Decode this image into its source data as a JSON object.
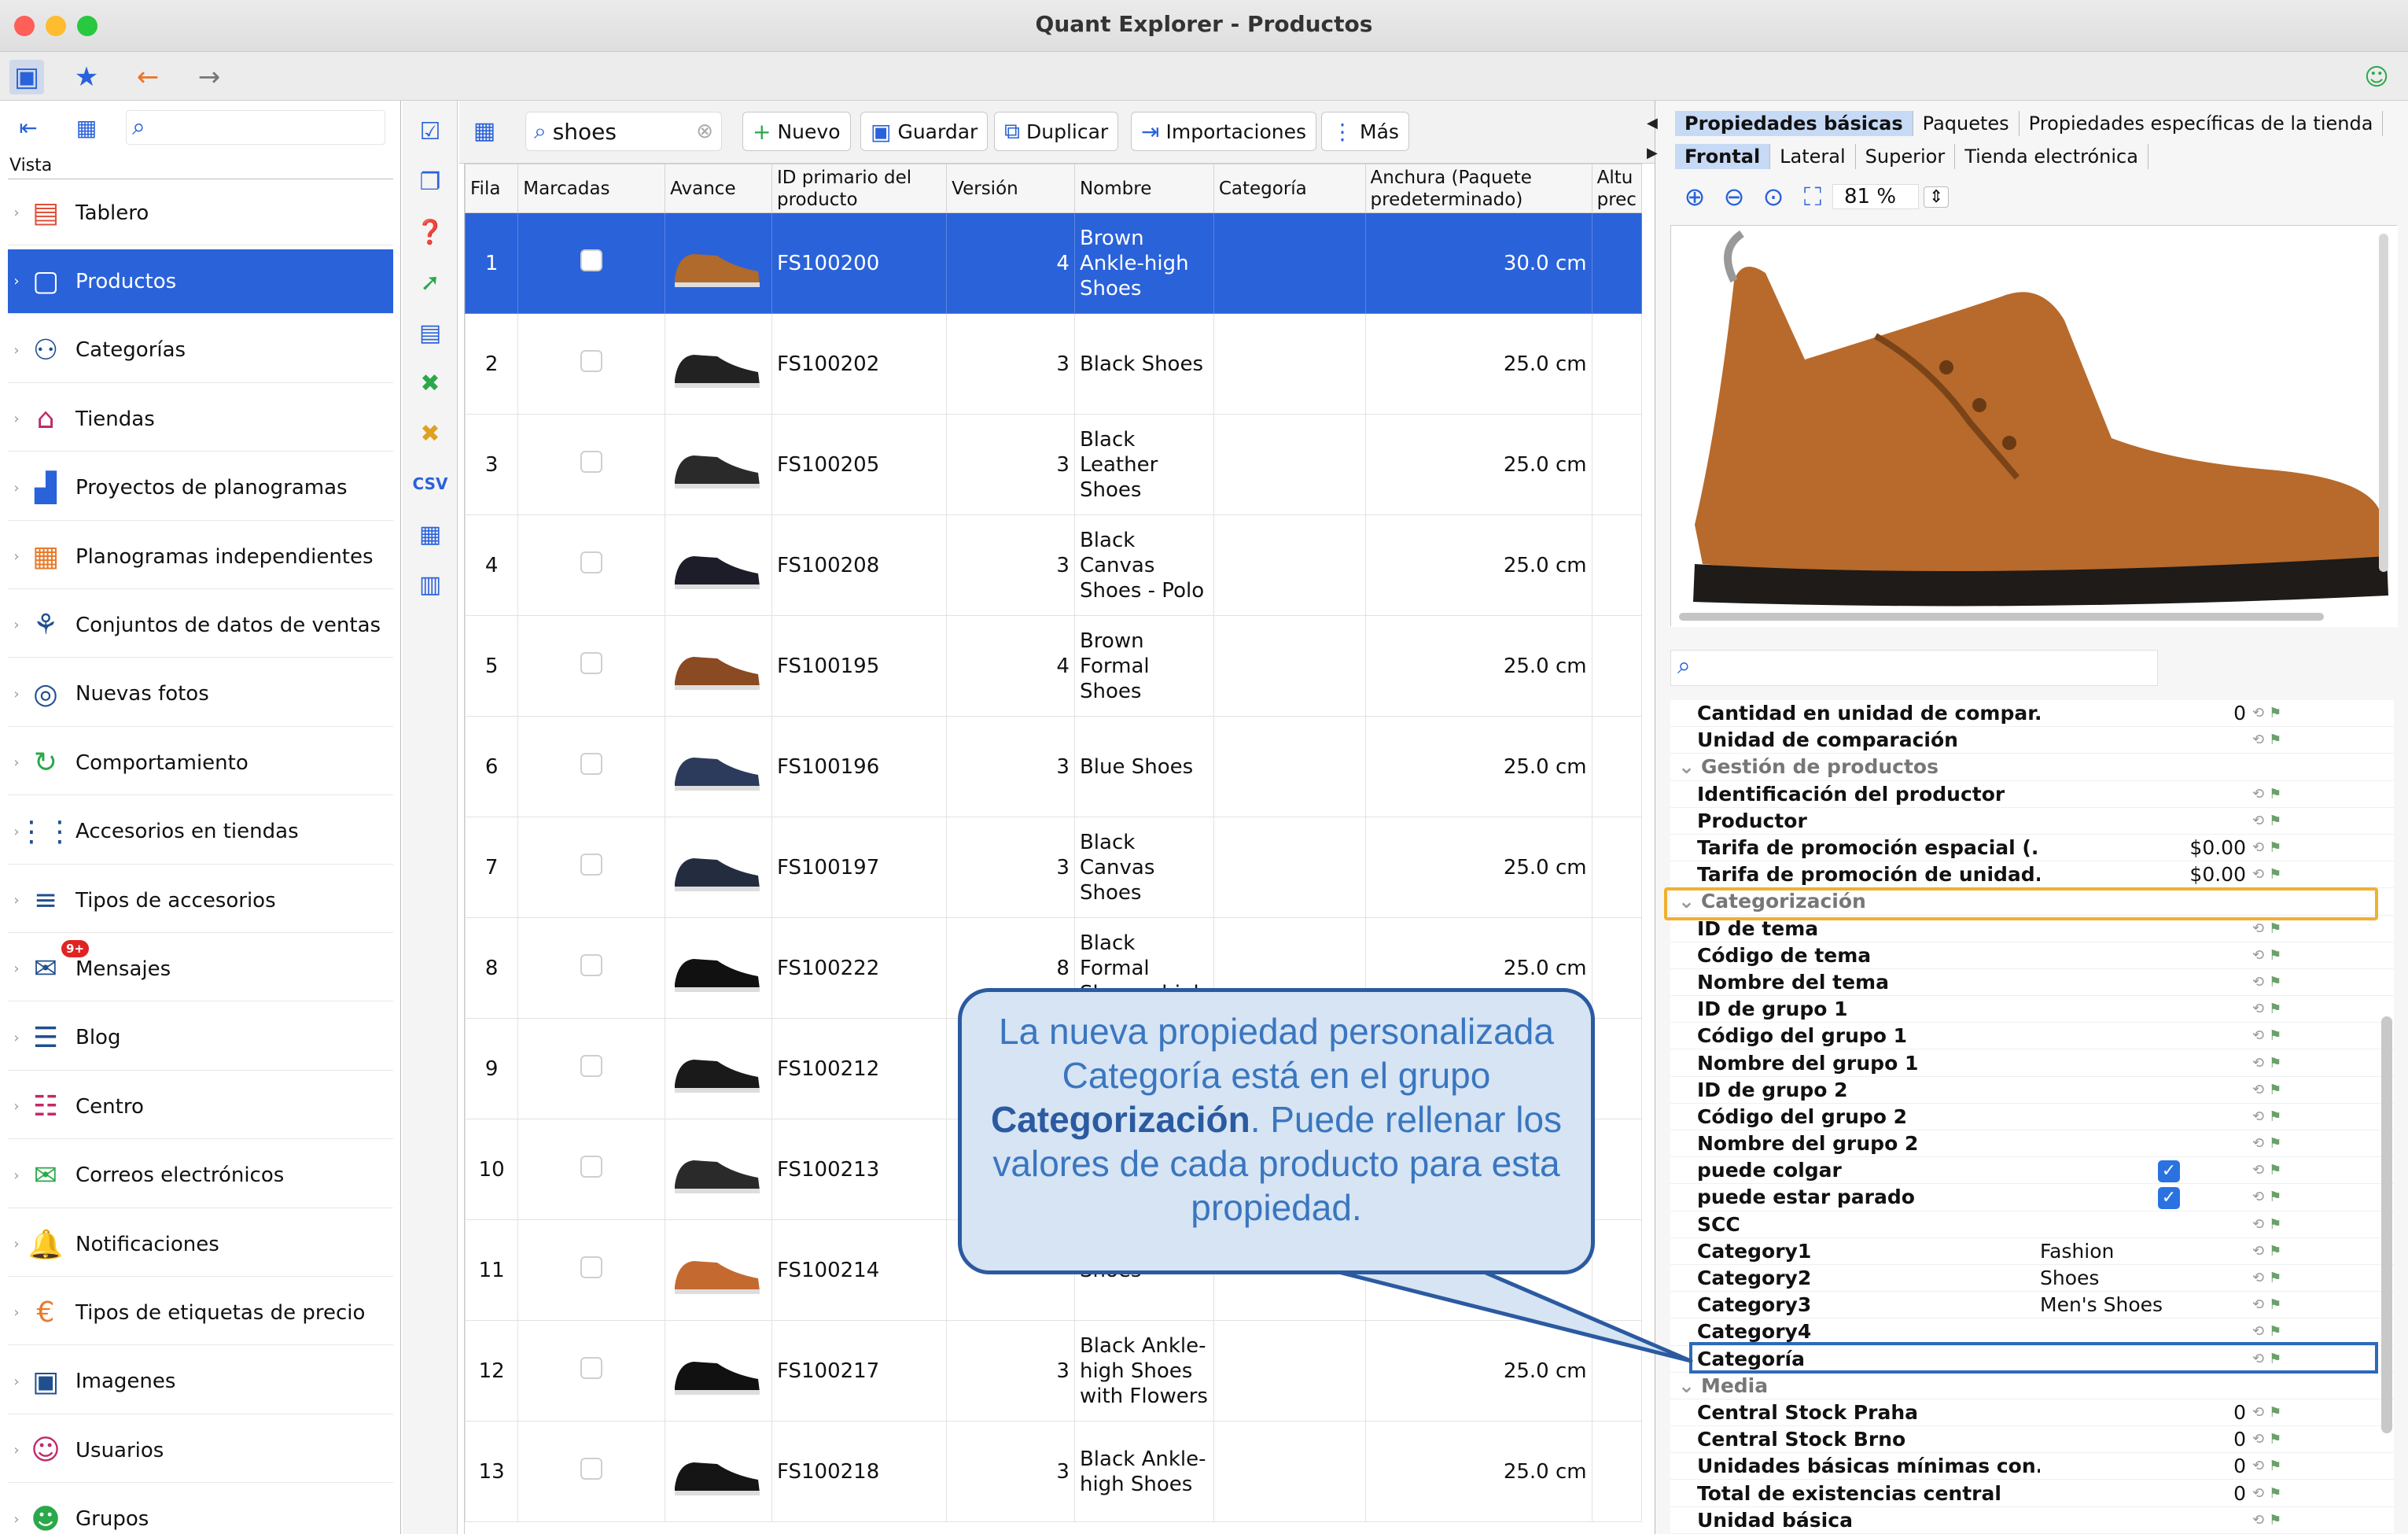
{
  "window": {
    "title": "Quant Explorer - Productos"
  },
  "sidebar": {
    "view_label": "Vista",
    "items": [
      {
        "label": "Tablero",
        "icon": "dashboard-icon"
      },
      {
        "label": "Productos",
        "icon": "product-icon",
        "selected": true
      },
      {
        "label": "Categorías",
        "icon": "categories-icon"
      },
      {
        "label": "Tiendas",
        "icon": "store-icon"
      },
      {
        "label": "Proyectos de planogramas",
        "icon": "planogram-projects-icon"
      },
      {
        "label": "Planogramas independientes",
        "icon": "planogram-icon"
      },
      {
        "label": "Conjuntos de datos de ventas",
        "icon": "sales-data-icon"
      },
      {
        "label": "Nuevas fotos",
        "icon": "camera-icon"
      },
      {
        "label": "Comportamiento",
        "icon": "behavior-icon"
      },
      {
        "label": "Accesorios en tiendas",
        "icon": "accessories-icon"
      },
      {
        "label": "Tipos de accesorios",
        "icon": "accessory-types-icon"
      },
      {
        "label": "Mensajes",
        "icon": "messages-icon",
        "badge": "9+"
      },
      {
        "label": "Blog",
        "icon": "blog-icon"
      },
      {
        "label": "Centro",
        "icon": "center-icon"
      },
      {
        "label": "Correos electrónicos",
        "icon": "email-icon"
      },
      {
        "label": "Notificaciones",
        "icon": "bell-icon"
      },
      {
        "label": "Tipos de etiquetas de precio",
        "icon": "price-tag-icon"
      },
      {
        "label": "Imagenes",
        "icon": "image-icon"
      },
      {
        "label": "Usuarios",
        "icon": "user-icon"
      },
      {
        "label": "Grupos",
        "icon": "group-icon"
      }
    ]
  },
  "toolbar": {
    "search_value": "shoes",
    "new_label": "Nuevo",
    "save_label": "Guardar",
    "duplicate_label": "Duplicar",
    "imports_label": "Importaciones",
    "more_label": "Más"
  },
  "table": {
    "headers": [
      "Fila",
      "Marcadas",
      "Avance",
      "ID primario del producto",
      "Versión",
      "Nombre",
      "Categoría",
      "Anchura (Paquete predeterminado)",
      "Altu prec"
    ],
    "rows": [
      {
        "fila": "1",
        "id": "FS100200",
        "version": "4",
        "name": "Brown Ankle-high Shoes",
        "width": "30.0 cm",
        "shoe": "#b06a2c"
      },
      {
        "fila": "2",
        "id": "FS100202",
        "version": "3",
        "name": "Black Shoes",
        "width": "25.0 cm",
        "shoe": "#222"
      },
      {
        "fila": "3",
        "id": "FS100205",
        "version": "3",
        "name": "Black Leather Shoes",
        "width": "25.0 cm",
        "shoe": "#2a2a2a"
      },
      {
        "fila": "4",
        "id": "FS100208",
        "version": "3",
        "name": "Black Canvas Shoes - Polo",
        "width": "25.0 cm",
        "shoe": "#1d1d2a"
      },
      {
        "fila": "5",
        "id": "FS100195",
        "version": "4",
        "name": "Brown Formal Shoes",
        "width": "25.0 cm",
        "shoe": "#8a4a22"
      },
      {
        "fila": "6",
        "id": "FS100196",
        "version": "3",
        "name": "Blue Shoes",
        "width": "25.0 cm",
        "shoe": "#2c3a5c"
      },
      {
        "fila": "7",
        "id": "FS100197",
        "version": "3",
        "name": "Black Canvas Shoes",
        "width": "25.0 cm",
        "shoe": "#242c40"
      },
      {
        "fila": "8",
        "id": "FS100222",
        "version": "8",
        "name": "Black Formal Shoes - high",
        "width": "25.0 cm",
        "shoe": "#111"
      },
      {
        "fila": "9",
        "id": "FS100212",
        "version": "",
        "name": "",
        "width": "",
        "shoe": "#1a1a1a"
      },
      {
        "fila": "10",
        "id": "FS100213",
        "version": "",
        "name": "",
        "width": "",
        "shoe": "#2a2a2a"
      },
      {
        "fila": "11",
        "id": "FS100214",
        "version": "",
        "name": "Shoes",
        "width": "",
        "shoe": "#c46a30"
      },
      {
        "fila": "12",
        "id": "FS100217",
        "version": "3",
        "name": "Black Ankle-high Shoes with Flowers",
        "width": "25.0 cm",
        "shoe": "#111"
      },
      {
        "fila": "13",
        "id": "FS100218",
        "version": "3",
        "name": "Black Ankle-high Shoes",
        "width": "25.0 cm",
        "shoe": "#151515"
      }
    ]
  },
  "properties_panel": {
    "tabs_row1": [
      "Propiedades básicas",
      "Paquetes",
      "Propiedades específicas de la tienda"
    ],
    "tabs_row2": [
      "Frontal",
      "Lateral",
      "Superior",
      "Tienda electrónica"
    ],
    "zoom": "81 %",
    "rows": [
      {
        "name": "Cantidad en unidad de compar...",
        "value": "0",
        "align": "r"
      },
      {
        "name": "Unidad de comparación",
        "value": ""
      },
      {
        "name": "Gestión de productos",
        "group": true
      },
      {
        "name": "Identificación del productor",
        "value": ""
      },
      {
        "name": "Productor",
        "value": ""
      },
      {
        "name": "Tarifa de promoción espacial (...",
        "value": "$0.00",
        "align": "r"
      },
      {
        "name": "Tarifa de promoción de unidad...",
        "value": "$0.00",
        "align": "r"
      },
      {
        "name": "Categorización",
        "group": true,
        "highlight": "orange"
      },
      {
        "name": "ID de tema",
        "value": ""
      },
      {
        "name": "Código de tema",
        "value": ""
      },
      {
        "name": "Nombre del tema",
        "value": ""
      },
      {
        "name": "ID de grupo 1",
        "value": ""
      },
      {
        "name": "Código del grupo 1",
        "value": ""
      },
      {
        "name": "Nombre del grupo 1",
        "value": ""
      },
      {
        "name": "ID de grupo 2",
        "value": ""
      },
      {
        "name": "Código del grupo 2",
        "value": ""
      },
      {
        "name": "Nombre del grupo 2",
        "value": ""
      },
      {
        "name": "puede colgar",
        "check": true
      },
      {
        "name": "puede estar parado",
        "check": true
      },
      {
        "name": "SCC",
        "value": ""
      },
      {
        "name": "Category1",
        "value": "Fashion"
      },
      {
        "name": "Category2",
        "value": "Shoes"
      },
      {
        "name": "Category3",
        "value": "Men's Shoes"
      },
      {
        "name": "Category4",
        "value": ""
      },
      {
        "name": "Categoría",
        "value": "",
        "highlight": "blue"
      },
      {
        "name": "Media",
        "group": true
      },
      {
        "name": "Central Stock Praha",
        "value": "0",
        "align": "r"
      },
      {
        "name": "Central Stock Brno",
        "value": "0",
        "align": "r"
      },
      {
        "name": "Unidades básicas mínimas con...",
        "value": "0",
        "align": "r"
      },
      {
        "name": "Total de existencias central",
        "value": "0",
        "align": "r"
      },
      {
        "name": "Unidad básica",
        "value": "",
        "align": "r"
      }
    ]
  },
  "callout": {
    "text_before": "La nueva propiedad personalizada Categoría está en el grupo ",
    "text_bold": "Categorización",
    "text_after": ". Puede rellenar los valores de cada producto para esta propiedad."
  },
  "colors": {
    "selection": "#2a62d9",
    "accent": "#2a62d9",
    "callout_bg": "#d6e4f3",
    "callout_border": "#2b5aa0",
    "orange_highlight": "#f0b030"
  }
}
